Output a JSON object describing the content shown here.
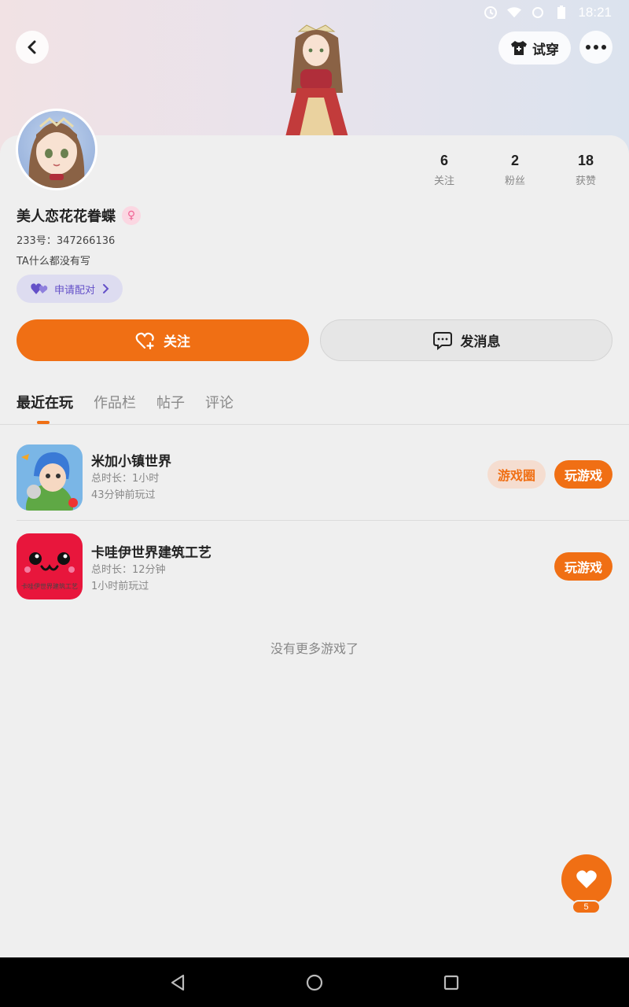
{
  "status_bar": {
    "time": "18:21"
  },
  "header": {
    "tryon_label": "试穿"
  },
  "profile": {
    "stats": [
      {
        "num": "6",
        "label": "关注"
      },
      {
        "num": "2",
        "label": "粉丝"
      },
      {
        "num": "18",
        "label": "获赞"
      }
    ],
    "username": "美人恋花花眷蝶",
    "uid": "233号：347266136",
    "bio": "TA什么都没有写",
    "pair_label": "申请配对"
  },
  "actions": {
    "follow_label": "关注",
    "message_label": "发消息"
  },
  "tabs": [
    {
      "label": "最近在玩",
      "active": true
    },
    {
      "label": "作品栏",
      "active": false
    },
    {
      "label": "帖子",
      "active": false
    },
    {
      "label": "评论",
      "active": false
    }
  ],
  "games": [
    {
      "title": "米加小镇世界",
      "duration": "总时长：1小时",
      "last_played": "43分钟前玩过",
      "circle_label": "游戏圈",
      "play_label": "玩游戏"
    },
    {
      "title": "卡哇伊世界建筑工艺",
      "duration": "总时长：12分钟",
      "last_played": "1小时前玩过",
      "play_label": "玩游戏",
      "icon_text": "卡哇伊世界建筑工艺"
    }
  ],
  "list_footer": "没有更多游戏了",
  "fab": {
    "count": "5"
  },
  "colors": {
    "accent": "#f06f14",
    "pair": "#6450c8",
    "gender": "#f06495"
  }
}
